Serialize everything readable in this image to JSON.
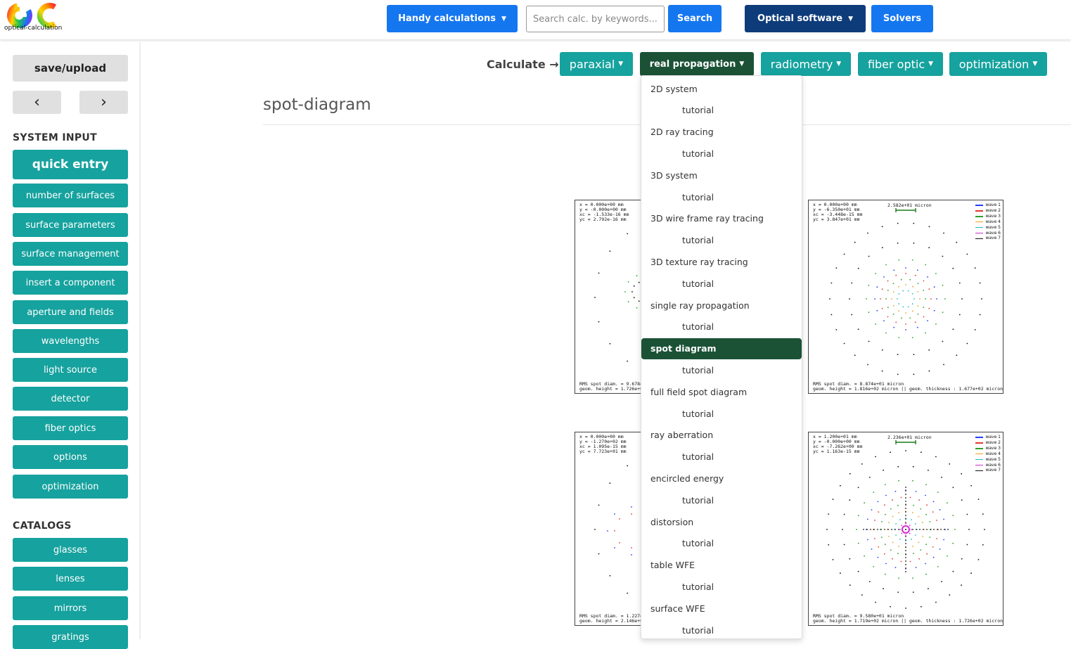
{
  "header": {
    "logo_text": "optical-calculation",
    "handy_label": "Handy calculations",
    "search_placeholder": "Search calc. by keywords...",
    "search_button": "Search",
    "optical_software_label": "Optical software",
    "solvers_label": "Solvers",
    "caret": "▼"
  },
  "sidebar": {
    "save_upload": "save/upload",
    "prev": "‹",
    "next": "›",
    "system_input_heading": "SYSTEM INPUT",
    "quick_entry": "quick entry",
    "items": [
      "number of surfaces",
      "surface parameters",
      "surface management",
      "insert a component",
      "aperture and fields",
      "wavelengths",
      "light source",
      "detector",
      "fiber optics",
      "options",
      "optimization"
    ],
    "catalogs_heading": "CATALOGS",
    "catalog_items": [
      "glasses",
      "lenses",
      "mirrors",
      "gratings"
    ]
  },
  "calcbar": {
    "label": "Calculate →",
    "tabs": [
      "paraxial",
      "real propagation",
      "radiometry",
      "fiber optic",
      "optimization"
    ],
    "active_tab": "real propagation"
  },
  "page": {
    "title": "spot-diagram"
  },
  "dropdown": {
    "items": [
      {
        "label": "2D system",
        "sub": false
      },
      {
        "label": "tutorial",
        "sub": true
      },
      {
        "label": "2D ray tracing",
        "sub": false
      },
      {
        "label": "tutorial",
        "sub": true
      },
      {
        "label": "3D system",
        "sub": false
      },
      {
        "label": "tutorial",
        "sub": true
      },
      {
        "label": "3D wire frame ray tracing",
        "sub": false
      },
      {
        "label": "tutorial",
        "sub": true
      },
      {
        "label": "3D texture ray tracing",
        "sub": false
      },
      {
        "label": "tutorial",
        "sub": true
      },
      {
        "label": "single ray propagation",
        "sub": false
      },
      {
        "label": "tutorial",
        "sub": true
      },
      {
        "label": "spot diagram",
        "sub": false,
        "active": true
      },
      {
        "label": "tutorial",
        "sub": true
      },
      {
        "label": "full field spot diagram",
        "sub": false
      },
      {
        "label": "tutorial",
        "sub": true
      },
      {
        "label": "ray aberration",
        "sub": false
      },
      {
        "label": "tutorial",
        "sub": true
      },
      {
        "label": "encircled energy",
        "sub": false
      },
      {
        "label": "tutorial",
        "sub": true
      },
      {
        "label": "distorsion",
        "sub": false
      },
      {
        "label": "tutorial",
        "sub": true
      },
      {
        "label": "table WFE",
        "sub": false
      },
      {
        "label": "tutorial",
        "sub": true
      },
      {
        "label": "surface WFE",
        "sub": false
      },
      {
        "label": "tutorial",
        "sub": true
      }
    ]
  },
  "plots": {
    "p1": {
      "info": "x = 0.000e+00 mm\ny = -0.000e+00 mm\nxc = -1.533e-16 mm\nyc = 2.792e-16 mm",
      "foot1": "RMS spot diam. = 9.678e+",
      "foot2": "geom. height = 1.726e+0"
    },
    "p2": {
      "info": "x = 0.000e+00 mm\ny = -6.350e+01 mm\nxc = -3.448e-15 mm\nyc = 3.847e+01 mm",
      "scale": "2.582e+01 micron",
      "foot1": "RMS spot diam. = 8.874e+01 micron",
      "foot2": "geom. height = 1.816e+02 micron || geom. thickness : 1.677e+02 micron"
    },
    "p3": {
      "info": "x = 0.000e+00 mm\ny = -1.270e+02 mm\nxc = 1.095e-15 mm\nyc = 7.723e+01 mm",
      "foot1": "RMS spot diam. = 1.227e+",
      "foot2": "geom. height = 2.146e+0"
    },
    "p4": {
      "info": "x = 1.200e+01 mm\ny = -0.000e+00 mm\nxc = -7.262e+00 mm\nyc = 1.163e-15 mm",
      "scale": "2.236e+01 micron",
      "foot1": "RMS spot diam. = 9.580e+01 micron",
      "foot2": "geom. height = 1.719e+02 micron || geom. thickness : 1.726e+02 micron"
    },
    "legend": [
      {
        "name": "wave 1",
        "color": "#1f3fff"
      },
      {
        "name": "wave 2",
        "color": "#e8382a"
      },
      {
        "name": "wave 3",
        "color": "#2ca02c"
      },
      {
        "name": "wave 4",
        "color": "#e8a317"
      },
      {
        "name": "wave 5",
        "color": "#17becf"
      },
      {
        "name": "wave 6",
        "color": "#d62ad6"
      },
      {
        "name": "wave 7",
        "color": "#111111"
      }
    ]
  },
  "colors": {
    "teal": "#16a29e",
    "blue": "#1577f0",
    "navy": "#0e3c7a",
    "active_green": "#1b5236"
  }
}
